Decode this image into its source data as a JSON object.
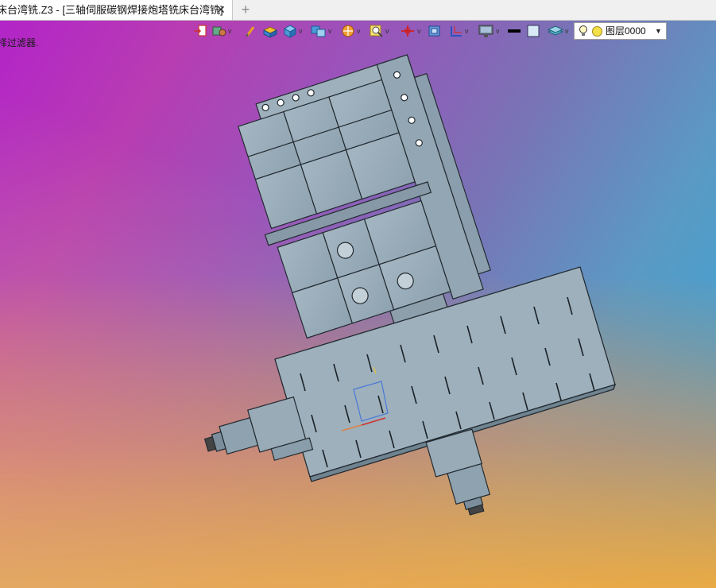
{
  "tab": {
    "label": "床台湾铣.Z3 - [三轴伺服碳钢焊接炮塔铣床台湾铣]",
    "close_symbol": "✕",
    "add_symbol": "+"
  },
  "hint_text": "择过滤器.",
  "toolbar": {
    "icons": [
      "import-icon",
      "snap-icon",
      "pen-icon",
      "box-icon",
      "cube-icon",
      "view-cube-icon",
      "render-icon",
      "zoom-icon",
      "axis-icon",
      "frame-icon",
      "dimension-icon",
      "display-icon",
      "line-color-icon",
      "fill-color-icon",
      "layer-stack-icon"
    ]
  },
  "layer": {
    "label": "图层0000",
    "color": "#f4e04a"
  },
  "colors": {
    "metal": "#98a9b6",
    "metal_dark": "#7d8f9d",
    "line": "#222a30"
  }
}
